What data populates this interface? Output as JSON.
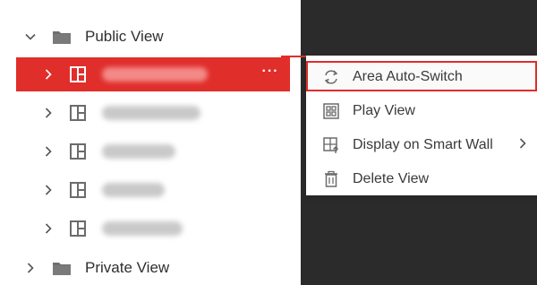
{
  "tree": {
    "public_view": {
      "label": "Public View",
      "expanded": true,
      "icon": "folder-icon"
    },
    "views": [
      {
        "selected": true,
        "icon": "view-layout-icon",
        "more_label": "···"
      },
      {
        "selected": false,
        "icon": "view-layout-icon"
      },
      {
        "selected": false,
        "icon": "view-layout-icon"
      },
      {
        "selected": false,
        "icon": "view-layout-icon"
      },
      {
        "selected": false,
        "icon": "view-layout-icon"
      }
    ],
    "private_view": {
      "label": "Private View",
      "expanded": false,
      "icon": "folder-icon"
    }
  },
  "context_menu": {
    "items": [
      {
        "label": "Area Auto-Switch",
        "icon": "auto-switch-icon",
        "highlighted": true
      },
      {
        "label": "Play View",
        "icon": "play-view-icon"
      },
      {
        "label": "Display on Smart Wall",
        "icon": "smart-wall-icon",
        "has_submenu": true
      },
      {
        "label": "Delete View",
        "icon": "trash-icon"
      }
    ]
  },
  "colors": {
    "accent": "#e02e2b",
    "dark_panel": "#2b2b2b",
    "text": "#333333",
    "icon_gray": "#6b6b6b"
  }
}
